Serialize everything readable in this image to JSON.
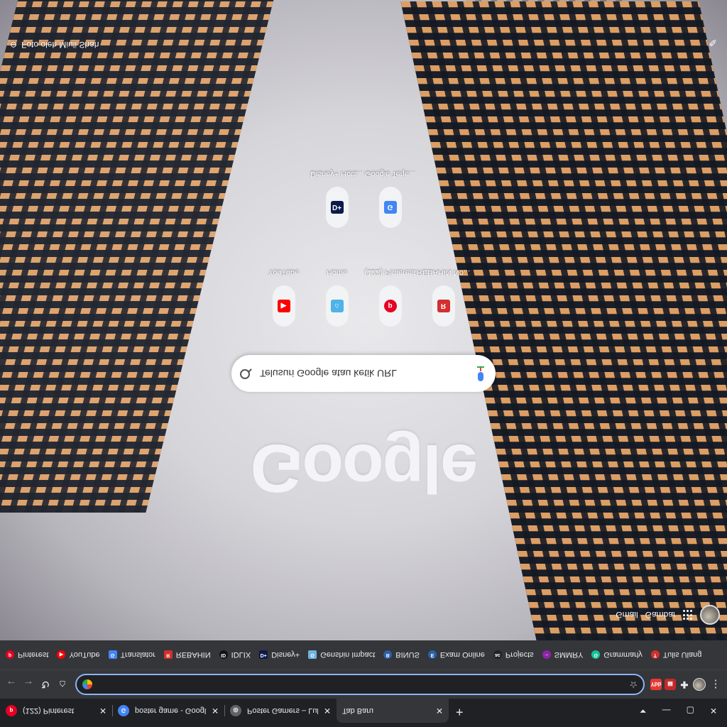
{
  "ntp": {
    "attribution": "Foto oleh Miuli Shah",
    "logo": "Google",
    "search_placeholder": "Telusuri Google atau ketik URL",
    "gmail": "Gmail",
    "gambar": "Gambar",
    "shortcuts_row1": [
      {
        "label": "YouTube",
        "icon": "youtube-icon",
        "color": "#ff0000"
      },
      {
        "label": "Home",
        "icon": "home-icon",
        "color": "#4fb3e8"
      },
      {
        "label": "(122) Pinterest",
        "icon": "pinterest-icon",
        "color": "#e60023"
      },
      {
        "label": "REBAHIN No...",
        "icon": "rebahin-icon",
        "color": "#d32f2f"
      }
    ],
    "shortcuts_row2": [
      {
        "label": "Disney+ Hots...",
        "icon": "disney-icon",
        "color": "#0c1a4a",
        "text": "D+"
      },
      {
        "label": "Google Terje...",
        "icon": "translate-icon",
        "color": "#4285f4",
        "text": "G"
      }
    ]
  },
  "tabs": [
    {
      "title": "(122) Pinterest",
      "icon": "pinterest-icon",
      "color": "#e60023"
    },
    {
      "title": "poster game - Google Penelusuran",
      "icon": "google-icon",
      "color": "#4285f4"
    },
    {
      "title": "Poster Gamers – Lukisan",
      "icon": "globe-icon",
      "color": "#9aa0a6"
    },
    {
      "title": "Tab Baru",
      "icon": "",
      "color": ""
    }
  ],
  "bookmarks": [
    {
      "label": "Pinterest",
      "color": "#e60023",
      "glyph": "p"
    },
    {
      "label": "YouTube",
      "color": "#ff0000",
      "glyph": "▶"
    },
    {
      "label": "Translator",
      "color": "#4285f4",
      "glyph": "G"
    },
    {
      "label": "REBAHIN",
      "color": "#d32f2f",
      "glyph": "R"
    },
    {
      "label": "IDLIX",
      "color": "#111111",
      "glyph": "ID"
    },
    {
      "label": "Disney+",
      "color": "#0c1a4a",
      "glyph": "D+"
    },
    {
      "label": "Genshin Impact",
      "color": "#6fb3e0",
      "glyph": "G"
    },
    {
      "label": "BINUS",
      "color": "#2b5fa8",
      "glyph": "B"
    },
    {
      "label": "Exam Online",
      "color": "#2b5fa8",
      "glyph": "E"
    },
    {
      "label": "Projects",
      "color": "#222222",
      "glyph": "ac"
    },
    {
      "label": "SMMRY",
      "color": "#8e24aa",
      "glyph": "→"
    },
    {
      "label": "Grammarly",
      "color": "#15c39a",
      "glyph": "G"
    },
    {
      "label": "Tulis Ulang",
      "color": "#d32f2f",
      "glyph": "T"
    }
  ],
  "omnibox": {
    "value": ""
  },
  "extensions": [
    {
      "name": "ybb-extension-icon",
      "color": "#e53935",
      "text": "Ybb"
    },
    {
      "name": "clipboard-extension-icon",
      "color": "#c62828",
      "text": "▤"
    },
    {
      "name": "puzzle-icon",
      "color": "#35363a",
      "text": "✚"
    }
  ]
}
